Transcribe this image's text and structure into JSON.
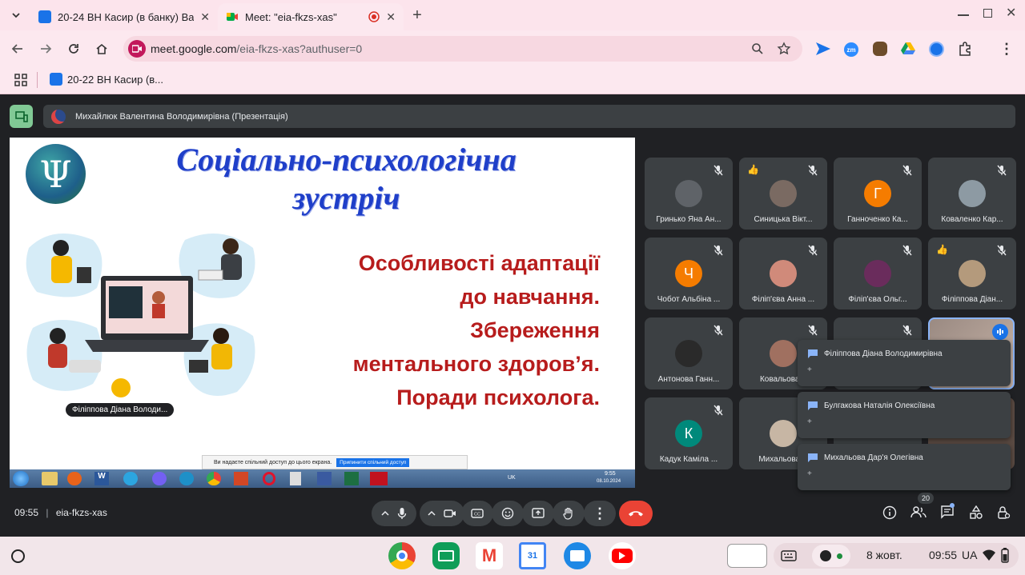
{
  "browser": {
    "tabs": [
      {
        "title": "20-24 ВН Касир (в банку) Вал...",
        "active": false
      },
      {
        "title": "Meet: \"eia-fkzs-xas\"",
        "active": true
      }
    ],
    "url_host": "meet.google.com",
    "url_path": "/eia-fkzs-xas?authuser=0",
    "bookmarks": [
      {
        "label": "20-22 ВН Касир (в..."
      }
    ]
  },
  "meet": {
    "presenter_label": "Михайлюк Валентина Володимирівна (Презентація)",
    "slide": {
      "title_line1": "Соціально-психологічна",
      "title_line2": "зустріч",
      "body_lines": [
        "Особливості адаптації",
        "до навчання.",
        "Збереження",
        "ментального здоров’я.",
        "Поради психолога."
      ],
      "name_tag": "Філіппова Діана Володи...",
      "share_notice": "Ви надаєте спільний доступ до цього екрана.",
      "stop_share": "Припинити спільний доступ",
      "taskbar_lang": "UK",
      "taskbar_time": "9:55",
      "taskbar_date": "08.10.2024"
    },
    "participants": [
      {
        "name": "Гринько Яна Ан...",
        "avatar": "photo",
        "color": "#5f6368"
      },
      {
        "name": "Синицька Вікт...",
        "avatar": "photo",
        "color": "#7a6a62",
        "emoji": "👍"
      },
      {
        "name": "Ганноченко Ка...",
        "avatar": "Г",
        "color": "#f57c00"
      },
      {
        "name": "Коваленко Кар...",
        "avatar": "photo",
        "color": "#8d9aa3"
      },
      {
        "name": "Чобот Альбіна ...",
        "avatar": "Ч",
        "color": "#f57c00"
      },
      {
        "name": "Філіп'єва Анна ...",
        "avatar": "photo",
        "color": "#d08a7a"
      },
      {
        "name": "Філіп'єва Ольг...",
        "avatar": "photo",
        "color": "#6a2c5c"
      },
      {
        "name": "Філіппова Діан...",
        "avatar": "photo",
        "color": "#b49a7c",
        "emoji": "👍"
      },
      {
        "name": "Антонова Ганн...",
        "avatar": "photo",
        "color": "#2a2a2a"
      },
      {
        "name": "Ковальова К",
        "avatar": "photo",
        "color": "#a07060"
      },
      {
        "name": "Кадук Каміла ...",
        "avatar": "К",
        "color": "#00897b"
      },
      {
        "name": "Михальова Д",
        "avatar": "photo",
        "color": "#c7b6a4"
      }
    ],
    "chat_popups": [
      {
        "name": "Філіппова Діана Володимирівна",
        "text": "+"
      },
      {
        "name": "Булгакова Наталія Олексіївна",
        "text": "+"
      },
      {
        "name": "Михальова Дар'я Олегівна",
        "text": "+"
      }
    ],
    "time": "09:55",
    "meeting_code": "eia-fkzs-xas",
    "people_count": "20"
  },
  "shelf": {
    "date": "8 жовт.",
    "time": "09:55",
    "lang": "UA",
    "calendar_day": "31"
  }
}
